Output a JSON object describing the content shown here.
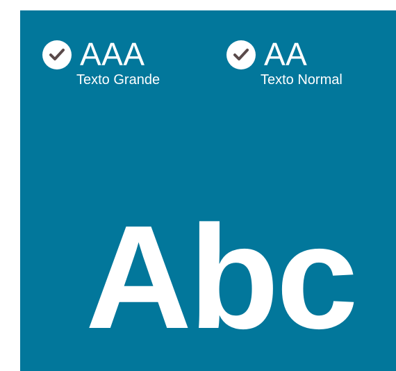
{
  "badges": {
    "aaa": {
      "icon": "check-circle-icon",
      "level": "AAA",
      "description": "Texto Grande"
    },
    "aa": {
      "icon": "check-circle-icon",
      "level": "AA",
      "description": "Texto Normal"
    }
  },
  "sample_text": "Abc",
  "colors": {
    "panel_background": "#02779b",
    "foreground": "#ffffff",
    "check_mark": "#5a4a4a"
  }
}
